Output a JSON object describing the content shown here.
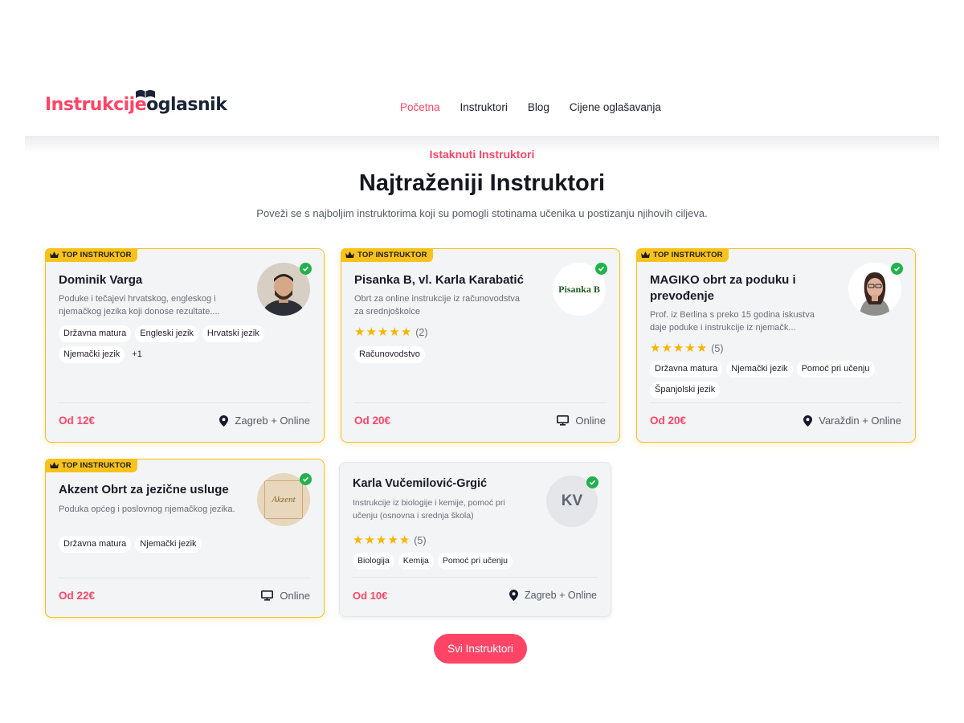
{
  "brand": {
    "part1": "Instrukcije",
    "part2": "oglasnik",
    "primary_color": "#ff4466",
    "dark_color": "#1b2437"
  },
  "nav": {
    "items": [
      "Početna",
      "Instruktori",
      "Blog",
      "Cijene oglašavanja"
    ],
    "active": "Početna"
  },
  "section": {
    "eyebrow": "Istaknuti Instruktori",
    "title": "Najtraženiji Instruktori",
    "subtitle": "Poveži se s najboljim instruktorima koji su pomogli stotinama učenika u postizanju njihovih ciljeva."
  },
  "cards": [
    {
      "badge": "TOP INSTRUKTOR",
      "name": "Dominik Varga",
      "desc1": "Poduke i tečajevi hrvatskog, engleskog i",
      "desc2": "njemačkog jezika koji donose rezultate....",
      "tags": [
        "Državna matura",
        "Engleski jezik",
        "Hrvatski jezik",
        "Njemački jezik"
      ],
      "more": "+1",
      "price": "Od 12€",
      "location": "Zagreb + Online",
      "location_icon": "map-pin-icon",
      "avatar": "photo"
    },
    {
      "badge": "TOP INSTRUKTOR",
      "name": "Pisanka B, vl. Karla Karabatić",
      "desc1": "Obrt za online instrukcije iz računovodstva",
      "desc2": "za srednjoškolce",
      "rating_count": "(2)",
      "tags": [
        "Računovodstvo"
      ],
      "price": "Od 20€",
      "location": "Online",
      "location_icon": "monitor-icon",
      "avatar_text": "Pisanka B"
    },
    {
      "badge": "TOP INSTRUKTOR",
      "name_line1": "MAGIKO obrt za poduku i",
      "name_line2": "prevođenje",
      "desc1": "Prof. iz Berlina s preko 15 godina iskustva",
      "desc2": "daje poduke i instrukcije iz njemačk...",
      "rating_count": "(5)",
      "tags": [
        "Državna matura",
        "Njemački jezik",
        "Pomoć pri učenju",
        "Španjolski jezik"
      ],
      "price": "Od 20€",
      "location": "Varaždin + Online",
      "location_icon": "map-pin-icon"
    },
    {
      "badge": "TOP INSTRUKTOR",
      "name": "Akzent Obrt za jezične usluge",
      "desc1": "Poduka općeg i poslovnog njemačkog jezika.",
      "tags": [
        "Državna matura",
        "Njemački jezik"
      ],
      "price": "Od 22€",
      "location": "Online",
      "location_icon": "monitor-icon",
      "avatar_text": "Akzent"
    },
    {
      "name": "Karla Vučemilović-Grgić",
      "desc1": "Instrukcije iz biologije i kemije, pomoć pri",
      "desc2": "učenju (osnovna i srednja škola)",
      "rating_count": "(5)",
      "tags": [
        "Biologija",
        "Kemija",
        "Pomoć pri učenju"
      ],
      "price": "Od 10€",
      "location": "Zagreb + Online",
      "location_icon": "map-pin-icon",
      "avatar_initials": "KV"
    }
  ],
  "cta": {
    "label": "Svi Instruktori"
  },
  "colors": {
    "accent": "#ff4466",
    "badge": "#f7c21c",
    "star": "#f7b500",
    "verified": "#21b24b",
    "card_bg": "#f3f4f6"
  }
}
